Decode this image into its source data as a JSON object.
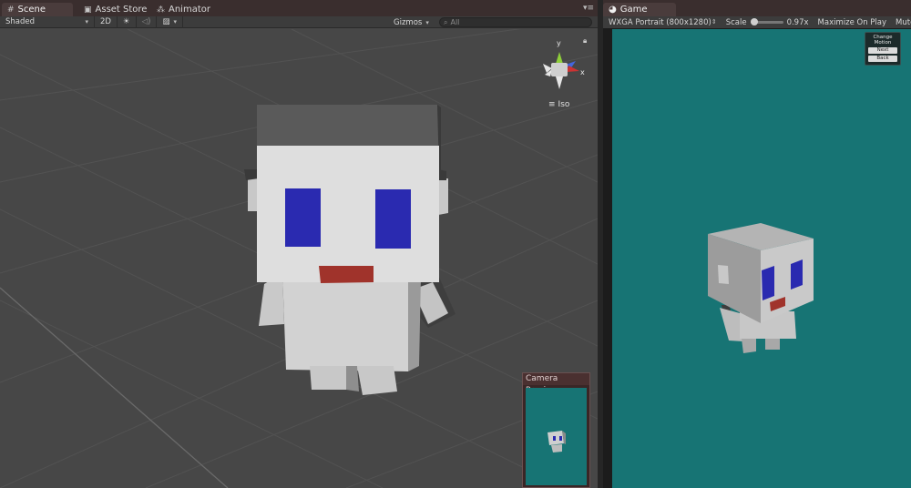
{
  "scene": {
    "tabs": [
      {
        "label": "Scene",
        "icon": "grid-icon"
      },
      {
        "label": "Asset Store",
        "icon": "store-icon"
      },
      {
        "label": "Animator",
        "icon": "animator-icon"
      }
    ],
    "toolbar": {
      "shading_mode": "Shaded",
      "mode_2d": "2D",
      "gizmos": "Gizmos",
      "search_placeholder": "All"
    },
    "projection_label": "Iso",
    "axis_labels": {
      "y": "y",
      "x": "x"
    },
    "camera_preview_title": "Camera Preview"
  },
  "game": {
    "tab_label": "Game",
    "resolution": "WXGA Portrait (800x1280)",
    "scale_label": "Scale",
    "scale_value": "0.97x",
    "maximize_on_play": "Maximize On Play",
    "mute_audio": "Mute Audio",
    "change_motion": {
      "title": "Change Motion",
      "next": "Next",
      "back": "Back"
    }
  },
  "colors": {
    "game_background": "#177474",
    "eye_color": "#2a2ab0",
    "mouth_color": "#a0332b",
    "scene_background": "#474747"
  }
}
